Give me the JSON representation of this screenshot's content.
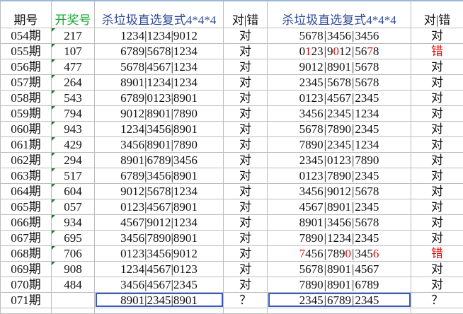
{
  "headers": {
    "period": "期号",
    "draw": "开奖号",
    "kill1": "杀垃圾直选复式4*4*4",
    "result1": "对|错",
    "kill2": "杀垃圾直选复式4*4*4",
    "result2": "对|错"
  },
  "colors": {
    "draw_header": "#1aa832",
    "kill_header": "#2f4a9a",
    "miss": "#e01010",
    "highlight_box": "#3a5bc0"
  },
  "rows": [
    {
      "period": "054期",
      "draw": "217",
      "kill1": "1234|1234|9012",
      "r1": "对",
      "kill2": [
        [
          "5678"
        ],
        [
          "3456"
        ],
        [
          "3456"
        ]
      ],
      "r2": "对"
    },
    {
      "period": "055期",
      "draw": "107",
      "kill1": "6789|5678|1234",
      "r1": "对",
      "kill2": [
        [
          "0",
          "1",
          "23"
        ],
        [
          "9",
          "0",
          "12"
        ],
        [
          "56",
          "7",
          "8"
        ]
      ],
      "r2": "错"
    },
    {
      "period": "056期",
      "draw": "477",
      "kill1": "5678|4567|1234",
      "r1": "对",
      "kill2": [
        [
          "9012"
        ],
        [
          "8901"
        ],
        [
          "5678"
        ]
      ],
      "r2": "对"
    },
    {
      "period": "057期",
      "draw": "264",
      "kill1": "8901|1234|1234",
      "r1": "对",
      "kill2": [
        [
          "2345"
        ],
        [
          "5678"
        ],
        [
          "5678"
        ]
      ],
      "r2": "对"
    },
    {
      "period": "058期",
      "draw": "543",
      "kill1": "6789|0123|8901",
      "r1": "对",
      "kill2": [
        [
          "0123"
        ],
        [
          "4567"
        ],
        [
          "2345"
        ]
      ],
      "r2": "对"
    },
    {
      "period": "059期",
      "draw": "794",
      "kill1": "9012|8901|7890",
      "r1": "对",
      "kill2": [
        [
          "3456"
        ],
        [
          "2345"
        ],
        [
          "1234"
        ]
      ],
      "r2": "对"
    },
    {
      "period": "060期",
      "draw": "943",
      "kill1": "1234|3456|8901",
      "r1": "对",
      "kill2": [
        [
          "5678"
        ],
        [
          "7890"
        ],
        [
          "2345"
        ]
      ],
      "r2": "对"
    },
    {
      "period": "061期",
      "draw": "429",
      "kill1": "3456|8901|7890",
      "r1": "对",
      "kill2": [
        [
          "7890"
        ],
        [
          "2345"
        ],
        [
          "1234"
        ]
      ],
      "r2": "对"
    },
    {
      "period": "062期",
      "draw": "294",
      "kill1": "8901|6789|3456",
      "r1": "对",
      "kill2": [
        [
          "2345"
        ],
        [
          "0123"
        ],
        [
          "7890"
        ]
      ],
      "r2": "对"
    },
    {
      "period": "063期",
      "draw": "517",
      "kill1": "6789|3456|8901",
      "r1": "对",
      "kill2": [
        [
          "0123"
        ],
        [
          "7890"
        ],
        [
          "2345"
        ]
      ],
      "r2": "对"
    },
    {
      "period": "064期",
      "draw": "604",
      "kill1": "9012|5678|1234",
      "r1": "对",
      "kill2": [
        [
          "3456"
        ],
        [
          "9012"
        ],
        [
          "5678"
        ]
      ],
      "r2": "对"
    },
    {
      "period": "065期",
      "draw": "057",
      "kill1": "0123|4567|8901",
      "r1": "对",
      "kill2": [
        [
          "4567"
        ],
        [
          "8901"
        ],
        [
          "2345"
        ]
      ],
      "r2": "对"
    },
    {
      "period": "066期",
      "draw": "934",
      "kill1": "4567|9012|1234",
      "r1": "对",
      "kill2": [
        [
          "8901"
        ],
        [
          "3456"
        ],
        [
          "5678"
        ]
      ],
      "r2": "对"
    },
    {
      "period": "067期",
      "draw": "695",
      "kill1": "3456|7890|8901",
      "r1": "对",
      "kill2": [
        [
          "7890"
        ],
        [
          "1234"
        ],
        [
          "2345"
        ]
      ],
      "r2": "对"
    },
    {
      "period": "068期",
      "draw": "706",
      "kill1": "0123|3456|9012",
      "r1": "对",
      "kill2": [
        [
          "",
          "7",
          "456"
        ],
        [
          "789",
          "0",
          ""
        ],
        [
          "345",
          "6",
          ""
        ]
      ],
      "r2": "错"
    },
    {
      "period": "069期",
      "draw": "908",
      "kill1": "1234|4567|0123",
      "r1": "对",
      "kill2": [
        [
          "5678"
        ],
        [
          "8901"
        ],
        [
          "4567"
        ]
      ],
      "r2": "对"
    },
    {
      "period": "070期",
      "draw": "484",
      "kill1": "3456|4567|2345",
      "r1": "对",
      "kill2": [
        [
          "7890"
        ],
        [
          "8901"
        ],
        [
          "6789"
        ]
      ],
      "r2": "对"
    },
    {
      "period": "071期",
      "draw": "",
      "kill1": "8901|2345|8901",
      "r1": "？",
      "kill2": [
        [
          "2345"
        ],
        [
          "6789"
        ],
        [
          "2345"
        ]
      ],
      "r2": "？"
    }
  ]
}
